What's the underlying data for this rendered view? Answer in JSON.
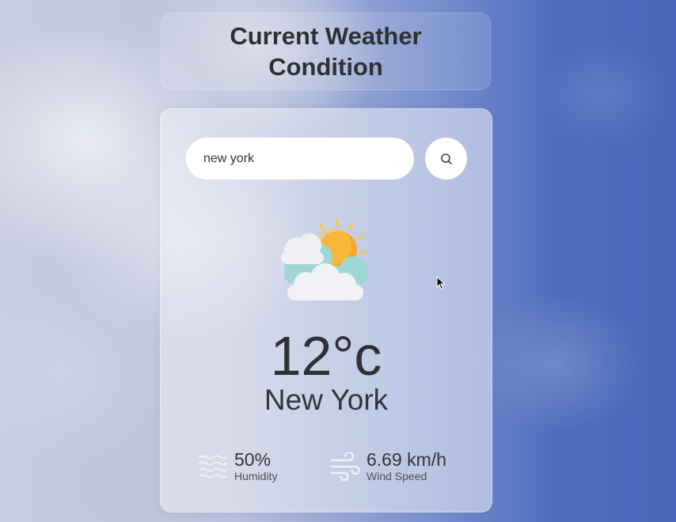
{
  "header": {
    "title": "Current Weather\nCondition"
  },
  "search": {
    "value": "new york",
    "button_icon": "search-icon"
  },
  "weather": {
    "icon": "partly-cloudy-sun-icon",
    "temperature": "12°c",
    "city": "New York"
  },
  "details": {
    "humidity": {
      "icon": "humidity-waves-icon",
      "value": "50%",
      "label": "Humidity"
    },
    "wind": {
      "icon": "wind-icon",
      "value": "6.69 km/h",
      "label": "Wind Speed"
    }
  },
  "colors": {
    "text_dark": "#2f3133",
    "card_glass": "rgba(238,240,246,0.55)",
    "sun": "#f5a623",
    "cloud_teal": "#9fd6d6"
  }
}
